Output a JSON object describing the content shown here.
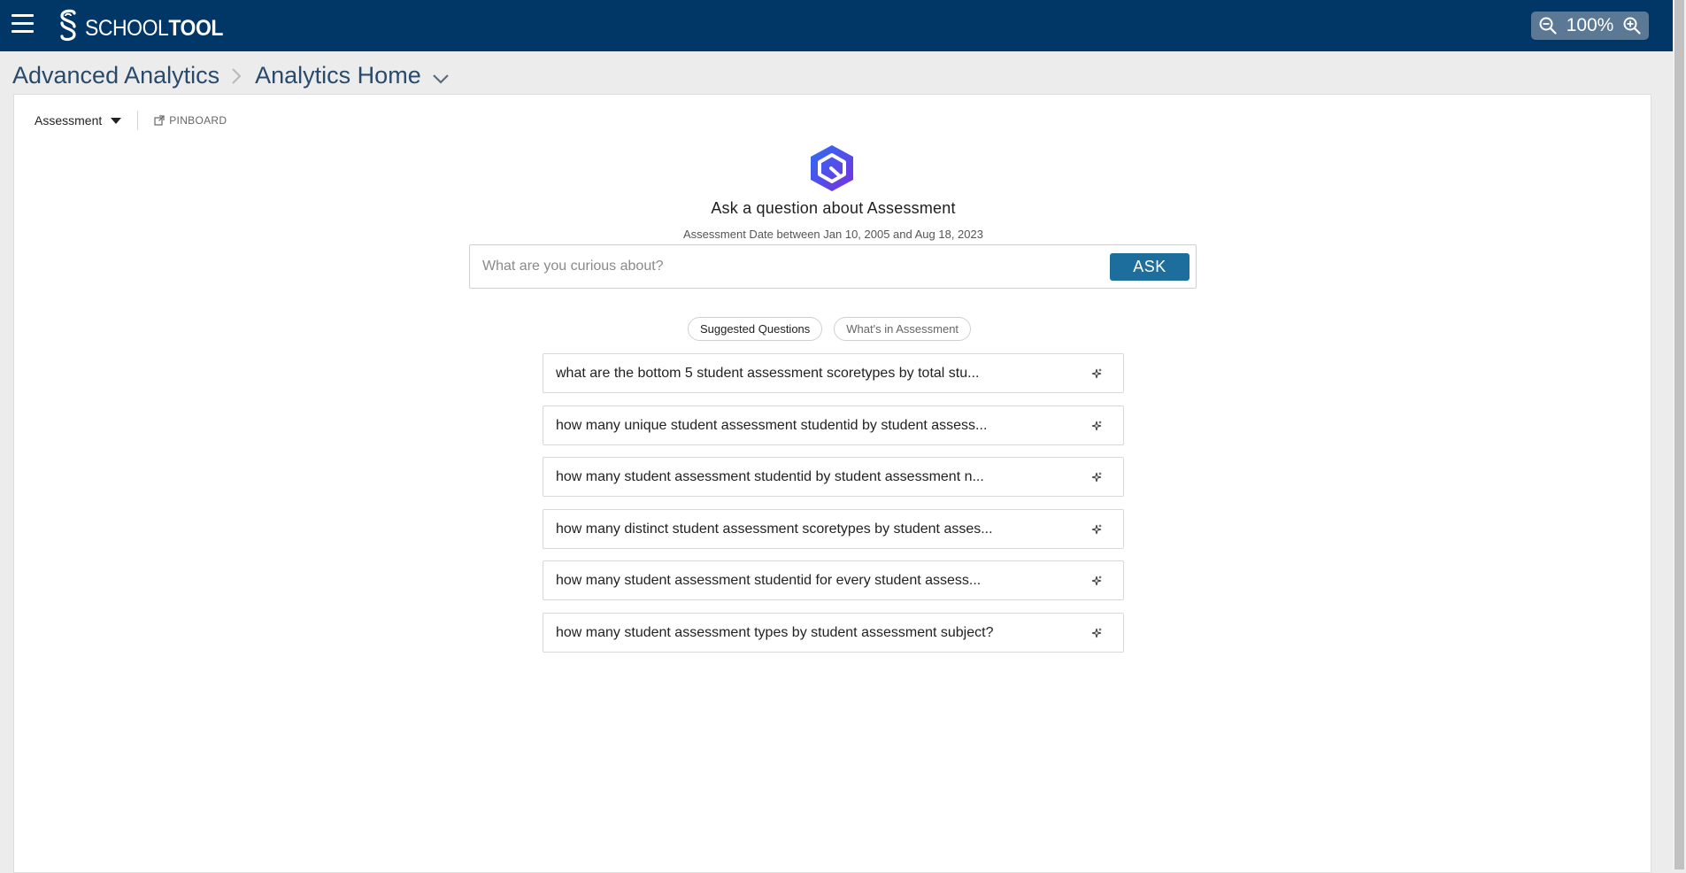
{
  "header": {
    "menu_icon": "hamburger-menu-icon",
    "logo_text_light": "SCHOOL",
    "logo_text_bold": "TOOL",
    "zoom_level": "100%",
    "colors": {
      "topbar": "#003767",
      "zoom_bg": "#5b7995"
    }
  },
  "breadcrumb": {
    "items": [
      "Advanced Analytics",
      "Analytics Home"
    ]
  },
  "toolbar": {
    "dataset_label": "Assessment",
    "pinboard_label": "PINBOARD"
  },
  "ask": {
    "heading": "Ask a question about Assessment",
    "subheading": "Assessment Date between Jan 10, 2005 and Aug 18, 2023",
    "placeholder": "What are you curious about?",
    "button_label": "ASK",
    "accent_color": "#1d6e9c"
  },
  "tabs": [
    {
      "label": "Suggested Questions",
      "active": true
    },
    {
      "label": "What's in Assessment",
      "active": false
    }
  ],
  "questions": [
    "what are the bottom 5 student assessment scoretypes by total stu...",
    "how many unique student assessment studentid by student assess...",
    "how many student assessment studentid by student assessment n...",
    "how many distinct student assessment scoretypes by student asses...",
    "how many student assessment studentid for every student assess...",
    "how many student assessment types by student assessment subject?"
  ]
}
